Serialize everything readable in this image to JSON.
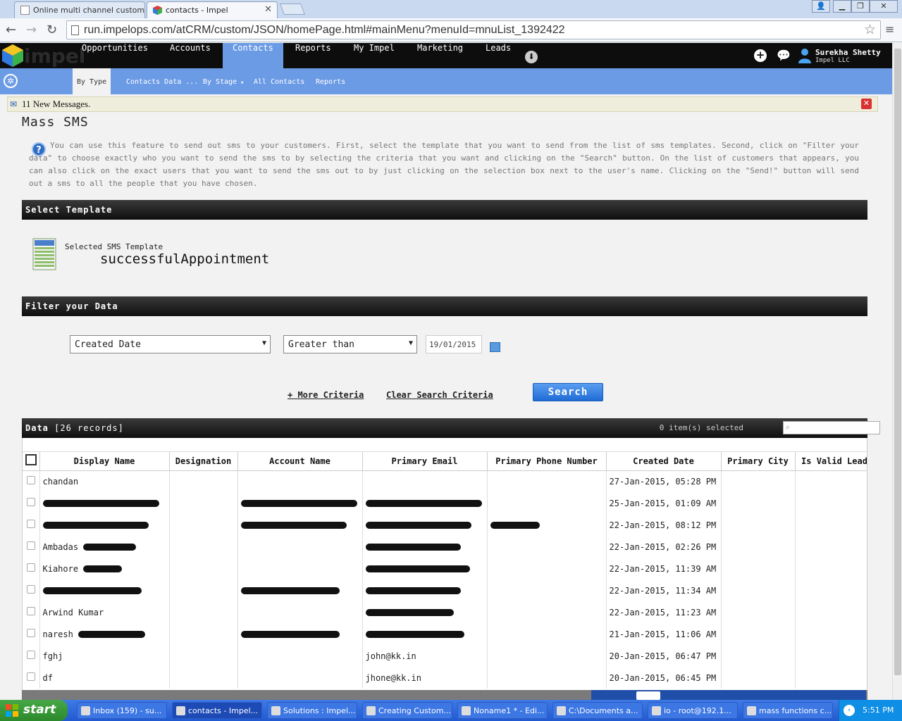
{
  "browser": {
    "tabs": [
      {
        "label": "Online multi channel custome",
        "active": false
      },
      {
        "label": "contacts - Impel",
        "active": true
      }
    ],
    "url": "run.impelops.com/atCRM/custom/JSON/homePage.html#mainMenu?menuId=mnuList_1392422"
  },
  "app": {
    "logo_text": "impel",
    "menu": [
      "Opportunities",
      "Accounts",
      "Contacts",
      "Reports",
      "My Impel",
      "Marketing",
      "Leads"
    ],
    "active_menu": "Contacts",
    "user": {
      "name": "Surekha Shetty",
      "company": "Impel LLC"
    },
    "submenu": [
      "By Type",
      "Contacts Data ...",
      "By Stage",
      "All Contacts",
      "Reports"
    ]
  },
  "messages": {
    "text": "11 New Messages."
  },
  "page": {
    "title": "Mass SMS",
    "help_text": "You can use this feature to send out sms to your customers. First, select the template that you want to send from the list of sms templates. Second, click on \"Filter your data\" to choose exactly who you want to send the sms to by selecting the criteria that you want and clicking on the \"Search\" button. On the list of customers that appears, you can also click on the exact users that you want to send the sms out to by just clicking on the selection box next to the user's name. Clicking on the \"Send!\" button will send out a sms to all the people that you have chosen."
  },
  "select_template": {
    "section_title": "Select Template",
    "label": "Selected SMS Template",
    "value": "successfulAppointment"
  },
  "filter": {
    "section_title": "Filter your Data",
    "field": "Created Date",
    "operator": "Greater than",
    "date_value": "19/01/2015",
    "more_criteria": "+ More Criteria",
    "clear_criteria": "Clear Search Criteria",
    "search_label": "Search"
  },
  "data": {
    "section_title": "Data",
    "record_count": "[26 records]",
    "selected_text": "0 item(s) selected",
    "columns": [
      "Display Name",
      "Designation",
      "Account Name",
      "Primary Email",
      "Primary Phone Number",
      "Created Date",
      "Primary City",
      "Is Valid Lead"
    ],
    "rows": [
      {
        "display_name": "chandan",
        "email": "",
        "created": "27-Jan-2015, 05:28 PM"
      },
      {
        "display_name": "",
        "email": "",
        "created": "25-Jan-2015, 01:09 AM"
      },
      {
        "display_name": "",
        "email": "",
        "created": "22-Jan-2015, 08:12 PM"
      },
      {
        "display_name": "Ambadas",
        "email": "",
        "created": "22-Jan-2015, 02:26 PM"
      },
      {
        "display_name": "Kiahore",
        "email": "",
        "created": "22-Jan-2015, 11:39 AM"
      },
      {
        "display_name": "",
        "email": "",
        "created": "22-Jan-2015, 11:34 AM"
      },
      {
        "display_name": "Arwind Kumar",
        "email": "",
        "created": "22-Jan-2015, 11:23 AM"
      },
      {
        "display_name": "naresh",
        "email": "",
        "created": "21-Jan-2015, 11:06 AM"
      },
      {
        "display_name": "fghj",
        "email": "john@kk.in",
        "created": "20-Jan-2015, 06:47 PM"
      },
      {
        "display_name": "df",
        "email": "jhone@kk.in",
        "created": "20-Jan-2015, 06:45 PM"
      }
    ]
  },
  "taskbar": {
    "start": "start",
    "tasks": [
      "Inbox (159) - su...",
      "contacts - Impel...",
      "Solutions : Impel...",
      "Creating Custom...",
      "Noname1 * - Edi...",
      "C:\\Documents a...",
      "io - root@192.1...",
      "mass functions c..."
    ],
    "active_task": 1,
    "clock": "5:51 PM"
  }
}
